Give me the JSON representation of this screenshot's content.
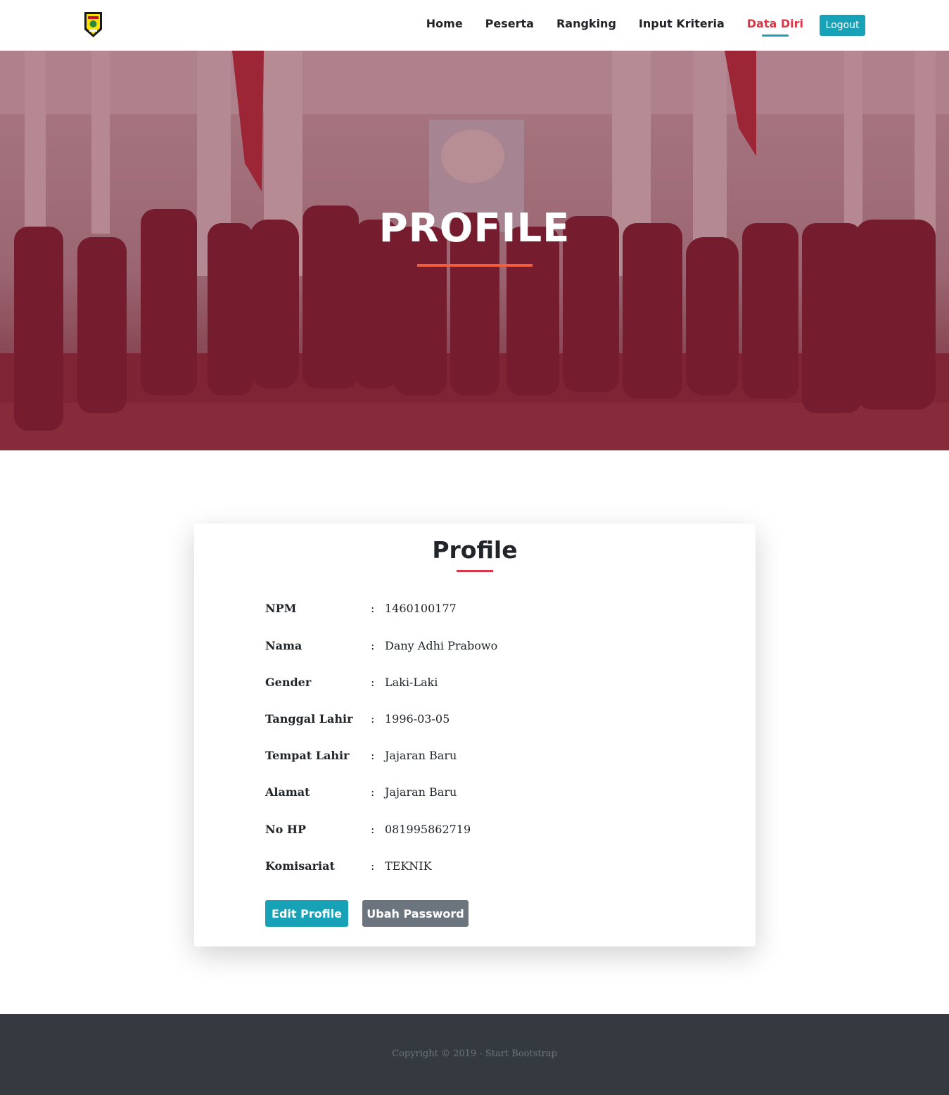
{
  "nav": {
    "links": [
      "Home",
      "Peserta",
      "Rangking",
      "Input Kriteria",
      "Data Diri"
    ],
    "active_index": 4,
    "logout_label": "Logout"
  },
  "hero": {
    "title": "PROFILE"
  },
  "profile": {
    "title": "Profile",
    "fields": [
      {
        "label": "NPM",
        "value": "1460100177"
      },
      {
        "label": "Nama",
        "value": "Dany Adhi Prabowo"
      },
      {
        "label": "Gender",
        "value": "Laki-Laki"
      },
      {
        "label": "Tanggal Lahir",
        "value": "1996-03-05"
      },
      {
        "label": "Tempat Lahir",
        "value": "Jajaran Baru"
      },
      {
        "label": "Alamat",
        "value": "Jajaran Baru"
      },
      {
        "label": "No HP",
        "value": "081995862719"
      },
      {
        "label": "Komisariat",
        "value": "TEKNIK"
      }
    ],
    "colon": ":",
    "edit_label": "Edit Profile",
    "password_label": "Ubah Password"
  },
  "footer": {
    "copyright": "Copyright © 2019 - Start Bootstrap"
  },
  "colors": {
    "accent": "#17a2b8",
    "active_nav": "#dc3545",
    "hero_divider": "#f05f40",
    "secondary": "#6c757d",
    "footer_bg": "#343a40"
  }
}
